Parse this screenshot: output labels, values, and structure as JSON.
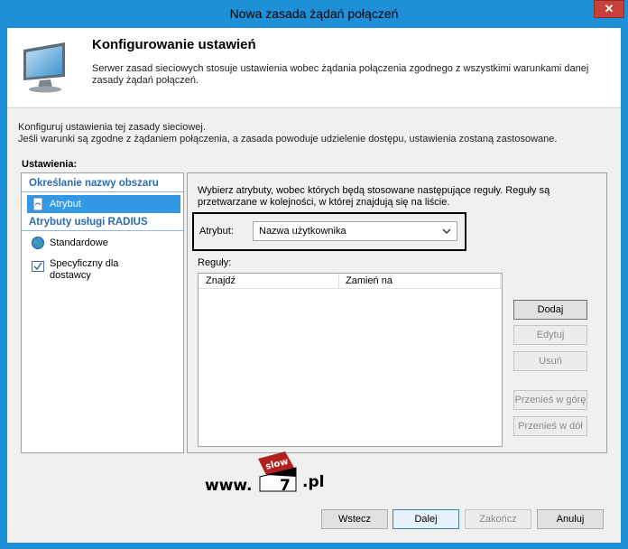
{
  "window": {
    "title": "Nowa zasada żądań połączeń",
    "close_glyph": "✕"
  },
  "header": {
    "title": "Konfigurowanie ustawień",
    "description": "Serwer zasad sieciowych stosuje ustawienia wobec żądania połączenia zgodnego z wszystkimi warunkami danej zasady żądań połączeń."
  },
  "intro": {
    "line1": "Konfiguruj ustawienia tej zasady sieciowej.",
    "line2": "Jeśli warunki są zgodne z żądaniem połączenia, a zasada powoduje udzielenie dostępu, ustawienia zostaną zastosowane."
  },
  "settings_label": "Ustawienia:",
  "sidebar": {
    "group1": "Określanie nazwy obszaru",
    "item_atrybut": "Atrybut",
    "group2": "Atrybuty usługi RADIUS",
    "item_standard": "Standardowe",
    "item_vendor_line1": "Specyficzny dla",
    "item_vendor_line2": "dostawcy"
  },
  "main": {
    "description": "Wybierz atrybuty, wobec których będą stosowane następujące reguły. Reguły są przetwarzane w kolejności, w której znajdują się na liście.",
    "attribute_label": "Atrybut:",
    "attribute_value": "Nazwa użytkownika",
    "rules_label": "Reguły:",
    "columns": [
      "Znajdź",
      "Zamień na"
    ],
    "buttons": {
      "add": "Dodaj",
      "edit": "Edytuj",
      "remove": "Usuń",
      "move_up": "Przenieś w górę",
      "move_down": "Przenieś w dół"
    }
  },
  "watermark": {
    "prefix": "www.",
    "badge_top": "slow",
    "badge_num": "7",
    "suffix": ".pl"
  },
  "footer": {
    "back": "Wstecz",
    "next": "Dalej",
    "finish": "Zakończ",
    "cancel": "Anuluj"
  },
  "colors": {
    "window_frame": "#1f8fd8",
    "selection": "#3399e6",
    "group_heading": "#2c6bb5",
    "close_button": "#c7413a"
  }
}
